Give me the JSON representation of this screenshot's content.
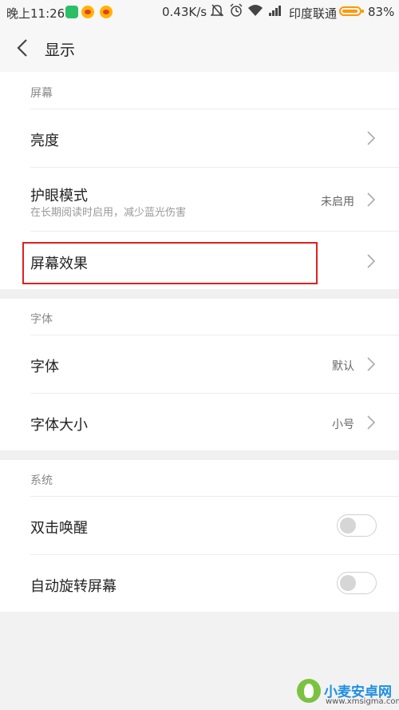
{
  "status_bar": {
    "time": "晚上11:26",
    "speed": "0.43K/s",
    "carrier": "印度联通",
    "battery_percent": "83%",
    "battery_level": 0.83,
    "icons": [
      "vpn-shield-icon",
      "weibo-icon",
      "weibo-icon",
      "mute-icon",
      "alarm-icon",
      "wifi-icon",
      "signal-icon",
      "battery-icon"
    ]
  },
  "header": {
    "title": "显示",
    "back_icon": "chevron-left-icon"
  },
  "sections": {
    "screen": {
      "header": "屏幕",
      "brightness": "亮度",
      "eye_mode": "护眼模式",
      "eye_mode_desc": "在长期阅读时启用，减少蓝光伤害",
      "eye_mode_value": "未启用",
      "screen_effect": "屏幕效果"
    },
    "font": {
      "header": "字体",
      "font": "字体",
      "font_value": "默认",
      "font_size": "字体大小",
      "font_size_value": "小号"
    },
    "system": {
      "header": "系统",
      "double_tap_wake": "双击唤醒",
      "double_tap_wake_on": false,
      "auto_rotate": "自动旋转屏幕",
      "auto_rotate_on": false
    }
  },
  "colors": {
    "highlight": "#e02020",
    "battery": "#ff9800"
  }
}
